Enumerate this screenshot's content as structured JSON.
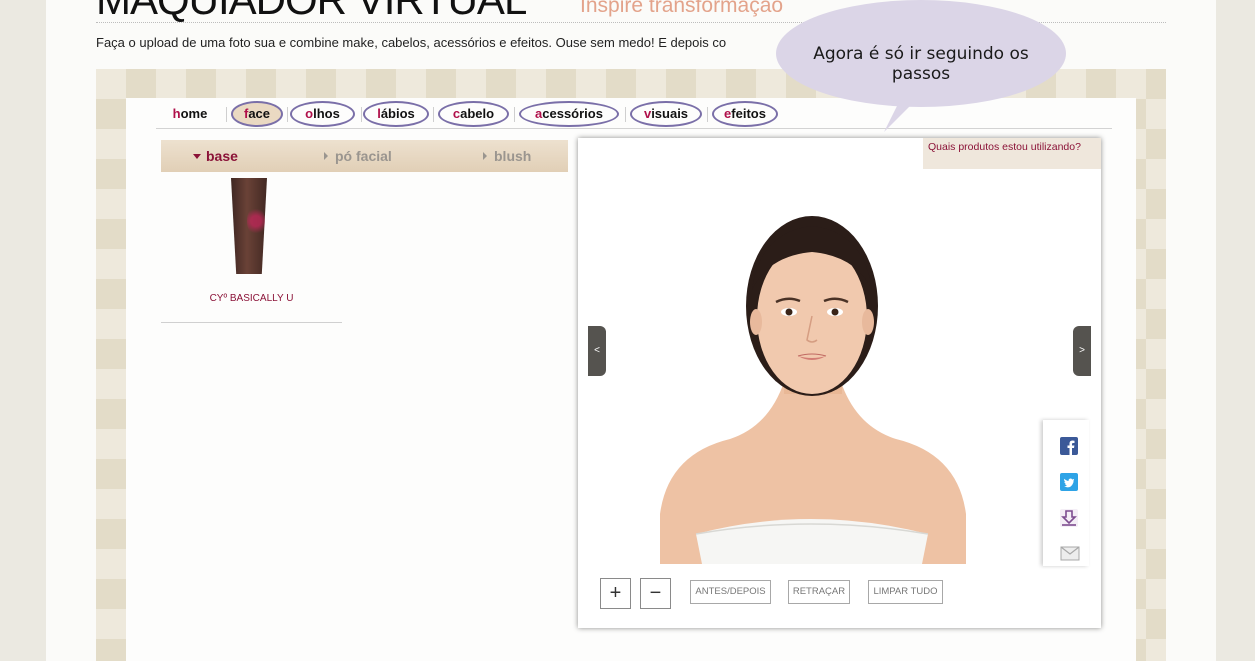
{
  "header": {
    "title": "MAQUIADOR VIRTUAL",
    "subtitle": "Inspire transformação",
    "intro": "Faça o upload de uma foto sua e combine make, cabelos, acessórios e efeitos. Ouse sem medo! E depois co"
  },
  "tabs": [
    {
      "first": "h",
      "rest": "ome"
    },
    {
      "first": "f",
      "rest": "ace"
    },
    {
      "first": "o",
      "rest": "lhos"
    },
    {
      "first": "l",
      "rest": "ábios"
    },
    {
      "first": "c",
      "rest": "abelo"
    },
    {
      "first": "a",
      "rest": "cessórios"
    },
    {
      "first": "v",
      "rest": "isuais"
    },
    {
      "first": "e",
      "rest": "feitos"
    }
  ],
  "subnav": {
    "base": "base",
    "po_facial": "pó facial",
    "blush": "blush"
  },
  "product": {
    "name": "CYº BASICALLY U"
  },
  "viewer": {
    "products_link": "Quais produtos estou utilizando?",
    "prev": "<",
    "next": ">",
    "zoom_in": "+",
    "zoom_out": "−",
    "before_after": "ANTES/DEPOIS",
    "retract": "RETRAÇAR",
    "clear_all": "LIMPAR TUDO"
  },
  "share_icons": [
    "facebook-icon",
    "twitter-icon",
    "download-icon",
    "email-icon"
  ],
  "bubble": {
    "text": "Agora é só ir seguindo os passos"
  },
  "colors": {
    "accent": "#8b1338",
    "tab_circle": "#7a6fa8",
    "active_tab": "#ead9c2",
    "bubble": "#dbd5e7"
  }
}
